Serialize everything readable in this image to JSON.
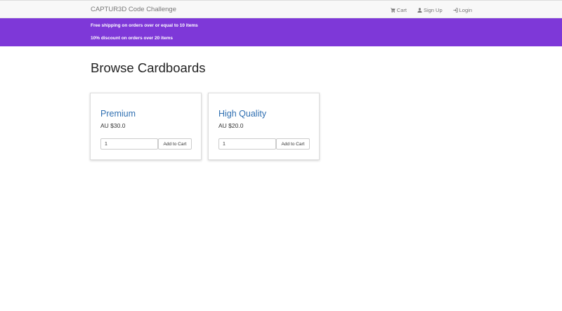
{
  "navbar": {
    "brand": "CAPTUR3D Code Challenge",
    "links": [
      {
        "label": "Cart",
        "icon": "cart-icon"
      },
      {
        "label": "Sign Up",
        "icon": "user-icon"
      },
      {
        "label": "Login",
        "icon": "login-icon"
      }
    ]
  },
  "promo": {
    "lines": [
      "Free shipping on orders over or equal to 10 items",
      "10% discount on orders over 20 items"
    ],
    "background": "#7e38d8"
  },
  "page": {
    "heading": "Browse Cardboards"
  },
  "products": [
    {
      "name": "Premium",
      "price": "AU $30.0",
      "quantity": "1",
      "button_label": "Add to Cart"
    },
    {
      "name": "High Quality",
      "price": "AU $20.0",
      "quantity": "1",
      "button_label": "Add to Cart"
    }
  ],
  "colors": {
    "accent": "#7e38d8",
    "product_title": "#2f6fb1",
    "navbar_bg": "#f8f8f8"
  }
}
